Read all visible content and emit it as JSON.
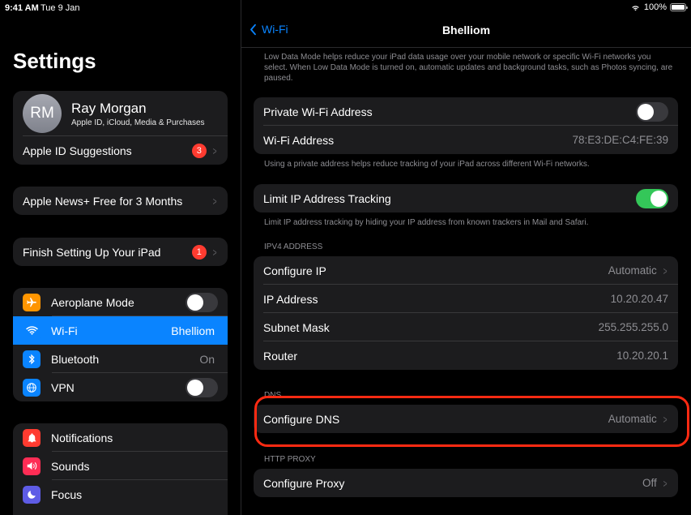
{
  "status_bar": {
    "time": "9:41 AM",
    "date": "Tue 9 Jan",
    "battery": "100%",
    "battery_level": 1.0
  },
  "sidebar": {
    "title": "Settings",
    "profile": {
      "initials": "RM",
      "name": "Ray Morgan",
      "subtitle": "Apple ID, iCloud, Media & Purchases"
    },
    "apple_id_suggestions": {
      "label": "Apple ID Suggestions",
      "badge": "3"
    },
    "apple_news": {
      "label": "Apple News+ Free for 3 Months"
    },
    "finish_setup": {
      "label": "Finish Setting Up Your iPad",
      "badge": "1"
    },
    "network_items": [
      {
        "label": "Aeroplane Mode",
        "toggle": false,
        "color": "#ff9500"
      },
      {
        "label": "Wi-Fi",
        "value": "Bhelliom",
        "color": "#0a84ff"
      },
      {
        "label": "Bluetooth",
        "value": "On",
        "color": "#0a84ff"
      },
      {
        "label": "VPN",
        "toggle": false,
        "color": "#0a84ff"
      }
    ],
    "notification_items": [
      {
        "label": "Notifications",
        "color": "#ff3b30"
      },
      {
        "label": "Sounds",
        "color": "#ff2d55"
      },
      {
        "label": "Focus",
        "color": "#5e5ce6"
      }
    ]
  },
  "detail": {
    "back_label": "Wi-Fi",
    "title": "Bhelliom",
    "low_data_note": "Low Data Mode helps reduce your iPad data usage over your mobile network or specific Wi-Fi networks you select. When Low Data Mode is turned on, automatic updates and background tasks, such as Photos syncing, are paused.",
    "private_address": {
      "label": "Private Wi-Fi Address",
      "on": false
    },
    "wifi_address": {
      "label": "Wi-Fi Address",
      "value": "78:E3:DE:C4:FE:39"
    },
    "private_note": "Using a private address helps reduce tracking of your iPad across different Wi-Fi networks.",
    "limit_ip": {
      "label": "Limit IP Address Tracking",
      "on": true
    },
    "limit_note": "Limit IP address tracking by hiding your IP address from known trackers in Mail and Safari.",
    "ipv4_header": "IPV4 ADDRESS",
    "ipv4_rows": [
      {
        "label": "Configure IP",
        "value": "Automatic"
      },
      {
        "label": "IP Address",
        "value": "10.20.20.47"
      },
      {
        "label": "Subnet Mask",
        "value": "255.255.255.0"
      },
      {
        "label": "Router",
        "value": "10.20.20.1"
      }
    ],
    "dns_header": "DNS",
    "configure_dns": {
      "label": "Configure DNS",
      "value": "Automatic"
    },
    "proxy_header": "HTTP PROXY",
    "configure_proxy": {
      "label": "Configure Proxy",
      "value": "Off"
    }
  }
}
